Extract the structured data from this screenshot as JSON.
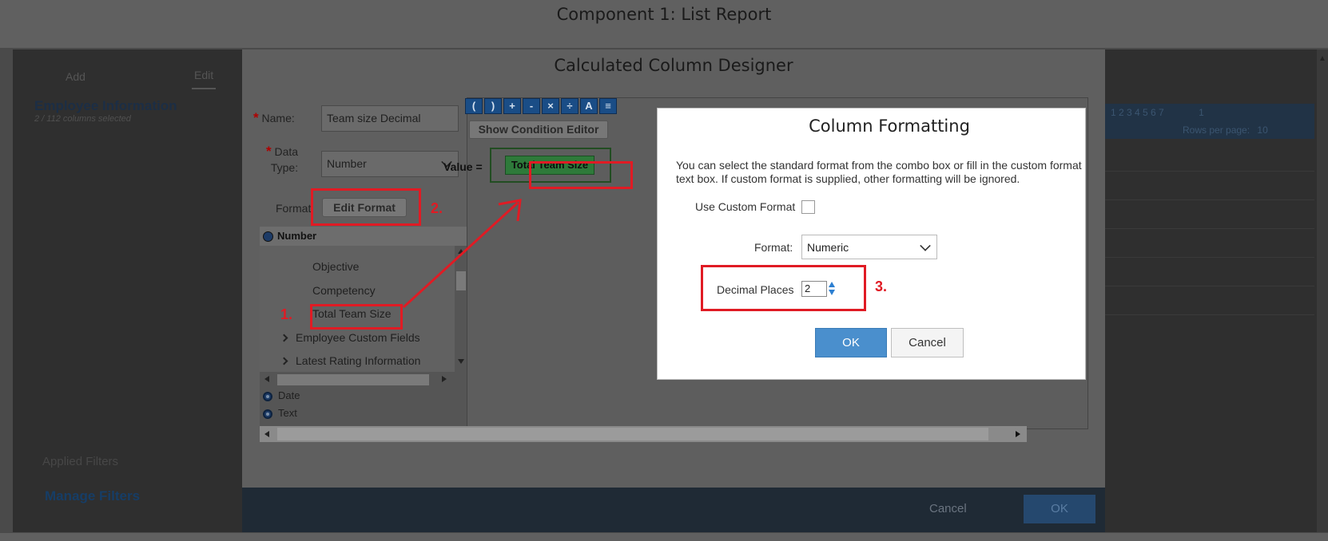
{
  "window": {
    "title": "Component 1: List Report"
  },
  "background": {
    "tabs": [
      "Add",
      "Edit"
    ],
    "section_title": "Employee Information",
    "section_subtitle": "2 / 112 columns selected",
    "applied_filters": "Applied Filters",
    "manage_filters": "Manage Filters",
    "pagination_text": "1 2 3 4 5 6 7",
    "rows_per_page_label": "Rows per page:",
    "rows_per_page_value": "10",
    "page_input_value": "1"
  },
  "designer": {
    "title": "Calculated Column Designer",
    "name_label": "Name:",
    "name_value": "Team size Decimal",
    "datatype_label_line1": "Data",
    "datatype_label_line2": "Type:",
    "datatype_value": "Number",
    "format_label": "Format:",
    "edit_format_button": "Edit Format",
    "tree": {
      "header": "Number",
      "items": [
        "Objective",
        "Competency",
        "Total Team Size"
      ],
      "groups": [
        "Employee Custom Fields",
        "Latest Rating Information"
      ],
      "categories": [
        "Date",
        "Text"
      ]
    },
    "toolbar_icons": [
      "(",
      ")",
      "+",
      "-",
      "×",
      "÷",
      "A",
      "≡"
    ],
    "show_condition_editor": "Show Condition Editor",
    "value_label": "Value =",
    "value_chip": "Total Team Size",
    "footer_cancel": "Cancel",
    "footer_ok": "OK"
  },
  "column_formatting": {
    "title": "Column Formatting",
    "description_line1": "You can select the standard format from the combo box or fill in the custom format",
    "description_line2": "text box. If custom format is supplied, other formatting will be ignored.",
    "use_custom_format_label": "Use Custom Format",
    "use_custom_format_checked": false,
    "format_label": "Format:",
    "format_value": "Numeric",
    "decimal_places_label": "Decimal Places",
    "decimal_places_value": "2",
    "ok_button": "OK",
    "cancel_button": "Cancel"
  },
  "annotations": {
    "step1": "1.",
    "step2": "2.",
    "step3": "3.",
    "color": "#e01b24"
  },
  "colors": {
    "accent_blue": "#4a8fcd",
    "value_chip_green": "#2e7a3a",
    "annotation_red": "#e01b24"
  }
}
